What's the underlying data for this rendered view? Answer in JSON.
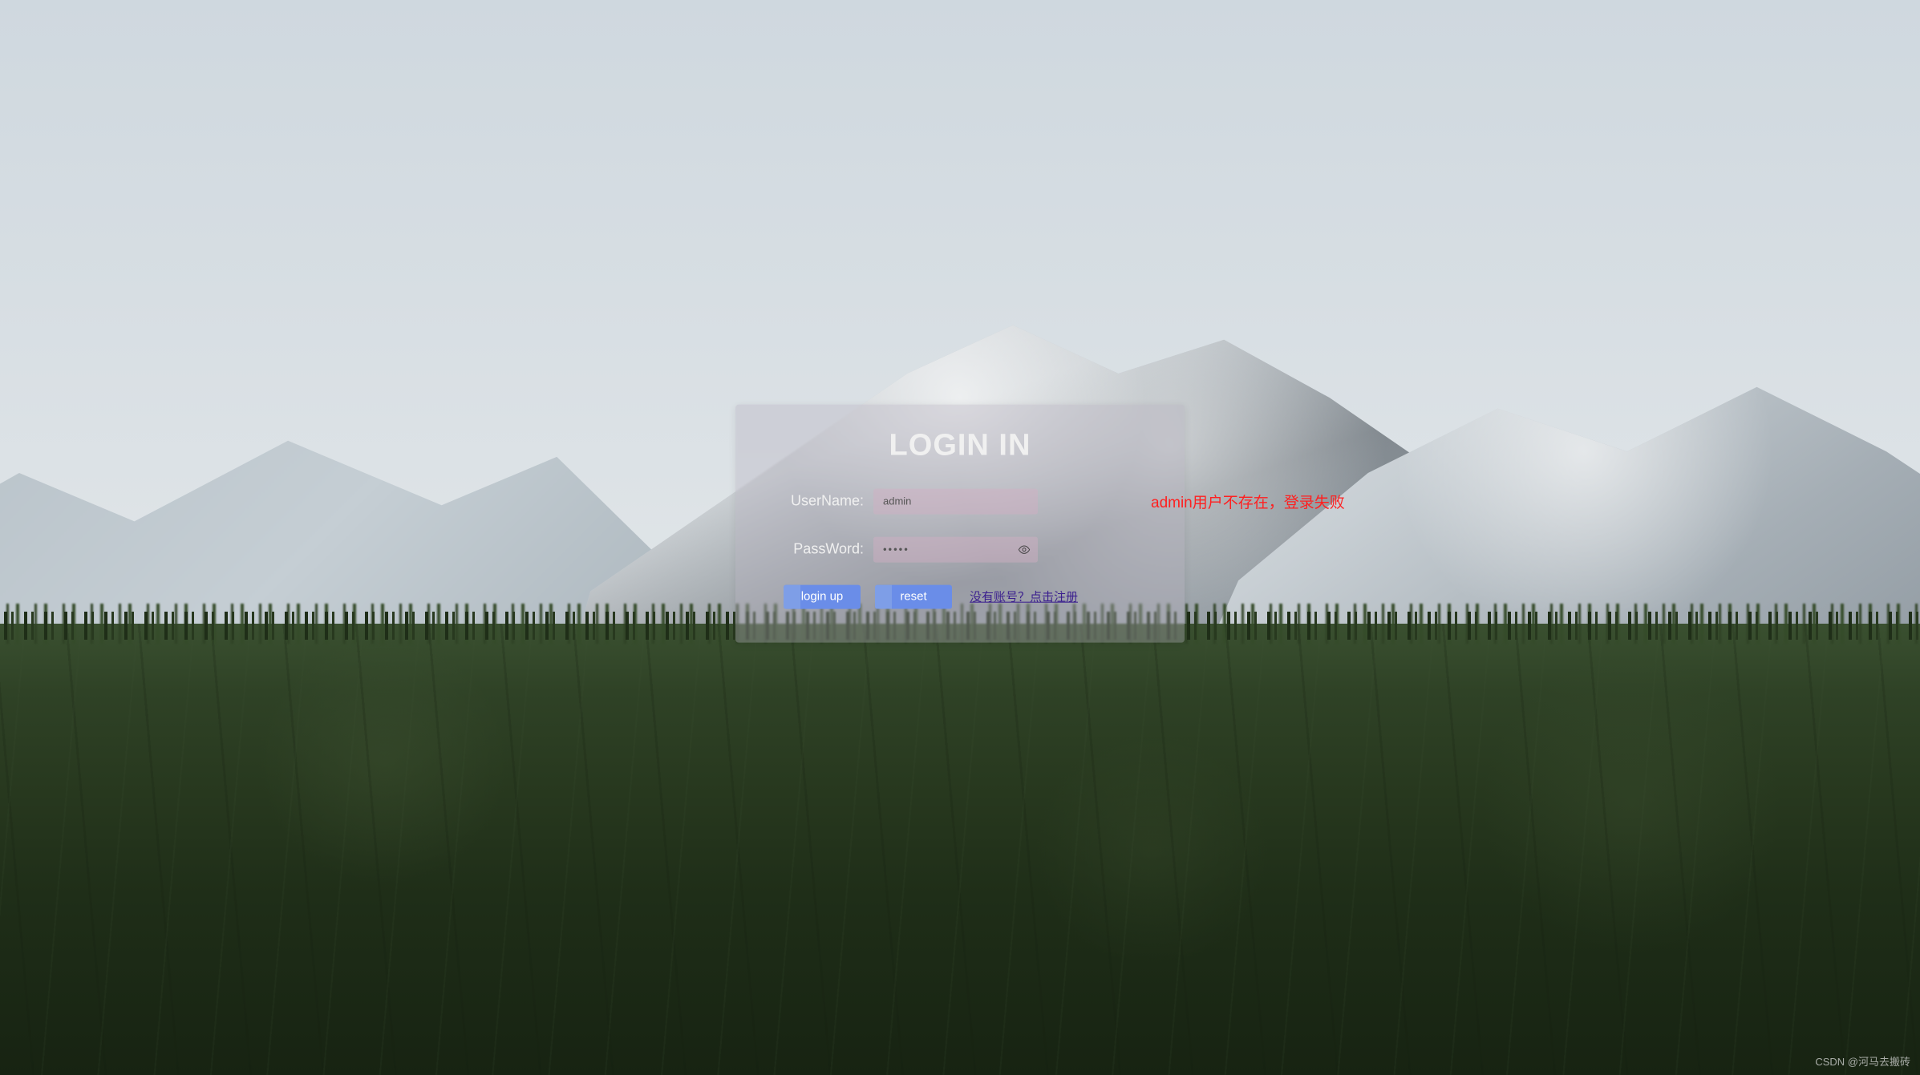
{
  "login": {
    "title": "LOGIN IN",
    "username_label": "UserName:",
    "username_value": "admin",
    "password_label": "PassWord:",
    "password_value": "•••••",
    "error_message": "admin用户不存在，登录失败",
    "login_button": "login up",
    "reset_button": "reset",
    "register_link": "没有账号？点击注册"
  },
  "watermark": "CSDN @河马去搬砖"
}
